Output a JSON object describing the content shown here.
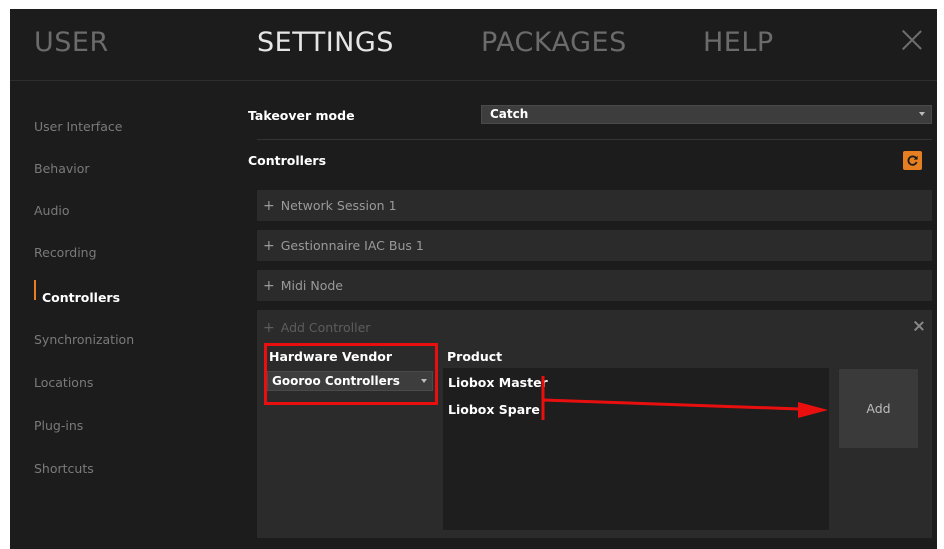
{
  "nav": {
    "tabs": [
      "USER",
      "SETTINGS",
      "PACKAGES",
      "HELP"
    ],
    "active_tab": "SETTINGS"
  },
  "sidebar": {
    "items": [
      "User Interface",
      "Behavior",
      "Audio",
      "Recording",
      "Controllers",
      "Synchronization",
      "Locations",
      "Plug-ins",
      "Shortcuts"
    ],
    "active_item": "Controllers"
  },
  "takeover": {
    "label": "Takeover mode",
    "value": "Catch"
  },
  "controllers": {
    "label": "Controllers",
    "items": [
      "Network Session 1",
      "Gestionnaire IAC Bus 1",
      "Midi Node"
    ]
  },
  "add_controller": {
    "header": "Add Controller",
    "vendor_label": "Hardware Vendor",
    "vendor_value": "Gooroo Controllers",
    "product_label": "Product",
    "products": [
      "Liobox Master",
      "Liobox Spare"
    ],
    "add_button": "Add"
  },
  "colors": {
    "background": "#1c1c1c",
    "accent": "#e67e22",
    "annotation": "#ea0f0f"
  },
  "icons": [
    "close-icon",
    "refresh-icon",
    "plus-icon",
    "chevron-down-icon"
  ]
}
